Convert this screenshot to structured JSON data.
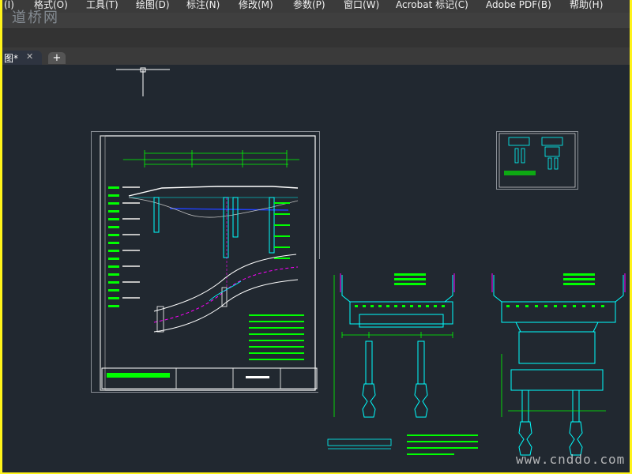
{
  "menubar": {
    "items": [
      "(I)",
      "格式(O)",
      "工具(T)",
      "绘图(D)",
      "标注(N)",
      "修改(M)",
      "参数(P)",
      "窗口(W)",
      "Acrobat 标记(C)",
      "Adobe PDF(B)",
      "帮助(H)"
    ]
  },
  "watermark_top": "道桥网",
  "tabs": {
    "doc_label": "图*",
    "close": "✕",
    "new": "+"
  },
  "watermark_bottom": "www.cnddo.com",
  "colors": {
    "frame": "#fff41a",
    "canvas": "#212830",
    "line_green": "#00ff00",
    "line_cyan": "#00e5ff",
    "line_magenta": "#ff00ff",
    "line_white": "#ffffff"
  }
}
